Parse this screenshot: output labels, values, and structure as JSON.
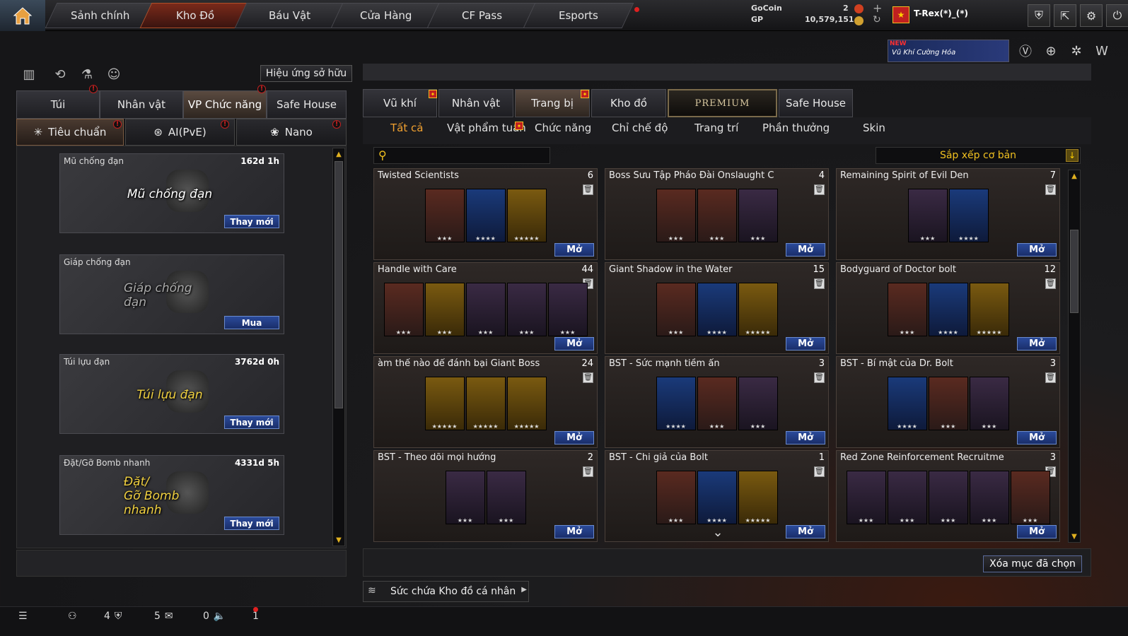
{
  "nav": {
    "tabs": [
      "Sảnh chính",
      "Kho Đồ",
      "Báu Vật",
      "Cửa Hàng",
      "CF Pass",
      "Esports"
    ],
    "active": "Kho Đồ"
  },
  "currency": {
    "gocoin_label": "GoCoin",
    "gocoin_value": "2",
    "gp_label": "GP",
    "gp_value": "10,579,151",
    "plus": "+"
  },
  "player": {
    "name": "T-Rex(*)_(*)"
  },
  "banner": {
    "badge": "NEW",
    "text": "Vũ Khí Cường Hóa"
  },
  "left": {
    "effect_button": "Hiệu ứng sở hữu",
    "tabs": [
      "Túi",
      "Nhân vật",
      "VP Chức năng",
      "Safe House"
    ],
    "subtabs": [
      "Tiêu chuẩn",
      "AI(PvE)",
      "Nano"
    ],
    "items": [
      {
        "name": "Mũ chống đạn",
        "time": "162d 1h",
        "art": "Mũ chống đạn",
        "button": "Thay mới"
      },
      {
        "name": "Giáp chống đạn",
        "time": "",
        "art": "Giáp chống đạn",
        "button": "Mua"
      },
      {
        "name": "Túi lựu đạn",
        "time": "3762d 0h",
        "art": "Túi lựu đạn",
        "button": "Thay mới"
      },
      {
        "name": "Đặt/Gỡ Bomb nhanh",
        "time": "4331d 5h",
        "art_line1": "Đặt/",
        "art_line2": "Gỡ Bomb nhanh",
        "button": "Thay mới"
      }
    ]
  },
  "right": {
    "tabs": [
      "Vũ khí",
      "Nhân vật",
      "Trang bị",
      "Kho đồ",
      "PREMIUM",
      "Safe House"
    ],
    "categories": [
      "Tất cả",
      "Vật phẩm tuần",
      "Chức năng",
      "Chỉ chế độ",
      "Trang trí",
      "Phần thưởng",
      "Skin"
    ],
    "sort_label": "Sắp xếp cơ bản",
    "open_label": "Mở",
    "cards": [
      {
        "title": "Twisted Scientists",
        "count": "6"
      },
      {
        "title": "Boss Sưu Tập Pháo Đài Onslaught C",
        "count": "4"
      },
      {
        "title": "Remaining Spirit of Evil Den",
        "count": "7"
      },
      {
        "title": "Handle with Care",
        "count": "44"
      },
      {
        "title": "Giant Shadow in the Water",
        "count": "15"
      },
      {
        "title": "Bodyguard of Doctor bolt",
        "count": "12"
      },
      {
        "title": "àm thế nào để đánh bại Giant Boss",
        "count": "24"
      },
      {
        "title": "BST - Sức mạnh tiềm ẩn",
        "count": "3"
      },
      {
        "title": "BST - Bí mật của Dr. Bolt",
        "count": "3"
      },
      {
        "title": "BST - Theo dõi mọi hướng",
        "count": "2"
      },
      {
        "title": "BST - Chi giả của Bolt",
        "count": "1"
      },
      {
        "title": "Red Zone Reinforcement Recruitme",
        "count": "3"
      }
    ],
    "delete_button": "Xóa mục đã chọn",
    "capacity_label": "Sức chứa Kho đồ cá nhân"
  },
  "status": {
    "clan": "4",
    "messages": "5",
    "voice": "0",
    "notif": "1"
  },
  "colors": {
    "accent": "#f0a030",
    "button_blue": "#1a2e6a",
    "alert": "#e02020"
  }
}
